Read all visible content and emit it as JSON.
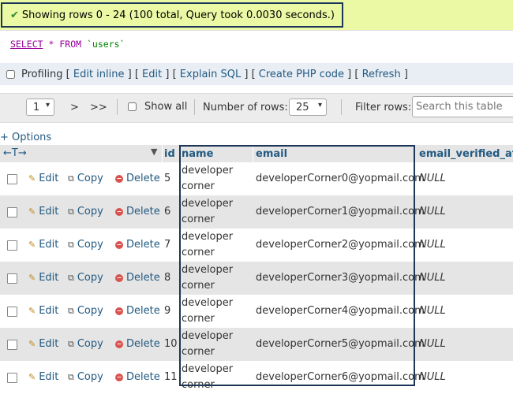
{
  "status": {
    "message": "Showing rows 0 - 24 (100 total, Query took 0.0030 seconds.)"
  },
  "sql": {
    "select": "SELECT",
    "star": "*",
    "from": "FROM",
    "table": "`users`"
  },
  "profiling": {
    "label": "Profiling",
    "links": [
      "Edit inline",
      "Edit",
      "Explain SQL",
      "Create PHP code",
      "Refresh"
    ]
  },
  "navigation": {
    "page_value": "1",
    "next": ">",
    "last": ">>",
    "show_all": "Show all",
    "rows_label": "Number of rows:",
    "rows_value": "25",
    "filter_label": "Filter rows:",
    "filter_placeholder": "Search this table"
  },
  "options_link": "+ Options",
  "table": {
    "arrows": "←T→",
    "columns": [
      "id",
      "name",
      "email",
      "email_verified_at"
    ],
    "actions": {
      "edit": "Edit",
      "copy": "Copy",
      "delete": "Delete"
    },
    "rows": [
      {
        "id": "5",
        "name1": "developer",
        "name2": "corner",
        "email": "developerCorner0@yopmail.com",
        "verified": "NULL"
      },
      {
        "id": "6",
        "name1": "developer",
        "name2": "corner",
        "email": "developerCorner1@yopmail.com",
        "verified": "NULL"
      },
      {
        "id": "7",
        "name1": "developer",
        "name2": "corner",
        "email": "developerCorner2@yopmail.com",
        "verified": "NULL"
      },
      {
        "id": "8",
        "name1": "developer",
        "name2": "corner",
        "email": "developerCorner3@yopmail.com",
        "verified": "NULL"
      },
      {
        "id": "9",
        "name1": "developer",
        "name2": "corner",
        "email": "developerCorner4@yopmail.com",
        "verified": "NULL"
      },
      {
        "id": "10",
        "name1": "developer",
        "name2": "corner",
        "email": "developerCorner5@yopmail.com",
        "verified": "NULL"
      },
      {
        "id": "11",
        "name1": "developer",
        "name2": "corner",
        "email": "developerCorner6@yopmail.com",
        "verified": "NULL"
      }
    ]
  }
}
